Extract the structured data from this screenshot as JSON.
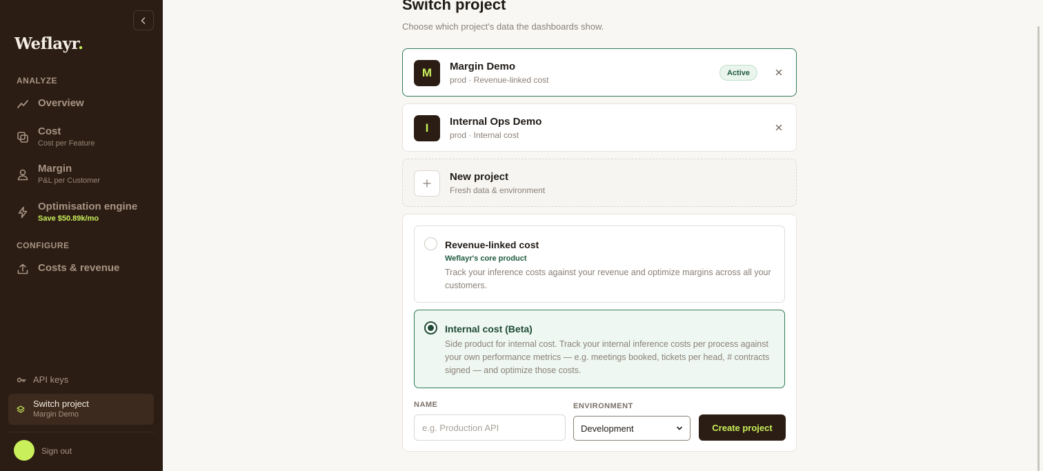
{
  "sidebar": {
    "logo": "Weflayr",
    "logo_dot": ".",
    "sections": {
      "analyze": "ANALYZE",
      "configure": "CONFIGURE"
    },
    "nav": {
      "overview": {
        "title": "Overview",
        "icon": "trend-line-icon"
      },
      "cost": {
        "title": "Cost",
        "sub": "Cost per Feature",
        "icon": "stack-icon"
      },
      "margin": {
        "title": "Margin",
        "sub": "P&L per Customer",
        "icon": "user-icon"
      },
      "optimisation": {
        "title": "Optimisation engine",
        "sub": "Save $50.89k/mo",
        "icon": "bolt-icon"
      },
      "costs_revenue": {
        "title": "Costs & revenue",
        "icon": "upload-icon"
      }
    },
    "api_keys": "API keys",
    "switch_project": {
      "title": "Switch project",
      "sub": "Margin Demo"
    },
    "sign_out": "Sign out"
  },
  "main": {
    "title": "Switch project",
    "subtitle": "Choose which project's data the dashboards show.",
    "projects": [
      {
        "initial": "M",
        "name": "Margin Demo",
        "meta": "prod · Revenue-linked cost",
        "badge": "Active"
      },
      {
        "initial": "I",
        "name": "Internal Ops Demo",
        "meta": "prod · Internal cost"
      }
    ],
    "new_project": {
      "title": "New project",
      "sub": "Fresh data & environment"
    },
    "options": [
      {
        "title": "Revenue-linked cost",
        "tag": "Weflayr's core product",
        "desc": "Track your inference costs against your revenue and optimize margins across all your customers."
      },
      {
        "title": "Internal cost (Beta)",
        "desc": "Side product for internal cost. Track your internal inference costs per process against your own performance metrics — e.g. meetings booked, tickets per head, # contracts signed — and optimize those costs."
      }
    ],
    "form": {
      "name_label": "NAME",
      "name_placeholder": "e.g. Production API",
      "env_label": "ENVIRONMENT",
      "env_value": "Development",
      "create_label": "Create project"
    }
  },
  "colors": {
    "sidebar_bg": "#2b1d14",
    "accent": "#c9ef5b",
    "active_border": "#2f7a58"
  }
}
